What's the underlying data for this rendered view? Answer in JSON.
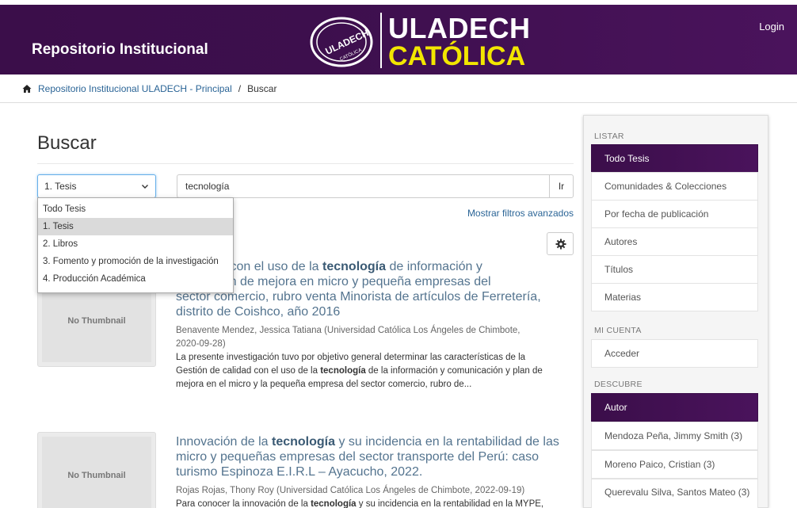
{
  "header": {
    "title": "Repositorio Institucional",
    "logo_word1": "ULADECH",
    "logo_word2": "CATÓLICA",
    "seal_text": "ULADECH CATÓLICA",
    "login": "Login"
  },
  "breadcrumb": {
    "home": "Repositorio Institucional ULADECH - Principal",
    "separator": "/",
    "current": "Buscar"
  },
  "search": {
    "page_title": "Buscar",
    "scope_selected": "1. Tesis",
    "query": "tecnología",
    "go_label": "Ir",
    "advanced_filters": "Mostrar filtros avanzados",
    "scope_options": [
      "Todo Tesis",
      "1. Tesis",
      "2. Libros",
      "3. Fomento y promoción de la investigación",
      "4. Producción Académica"
    ]
  },
  "results": [
    {
      "thumbnail": "No Thumbnail",
      "title_lines": [
        [
          "e calidad con el uso de la ",
          "tecnología",
          " de información y"
        ],
        [
          "ción y plan de mejora en micro y pequeña empresas del"
        ],
        [
          "sector comercio, rubro venta Minorista de artículos de Ferretería,"
        ],
        [
          "distrito de Coishco, año 2016"
        ]
      ],
      "meta_lines": [
        "Benavente Mendez, Jessica Tatiana (Universidad Católica Los Ángeles de Chimbote,",
        "2020-09-28)"
      ],
      "abstract_lines": [
        [
          "La presente investigación tuvo por objetivo general determinar las características de la"
        ],
        [
          "Gestión de calidad con el uso de la ",
          "tecnología",
          " de la información y comunicación y plan de"
        ],
        [
          "mejora en el micro y la pequeña empresa del sector comercio, rubro de..."
        ]
      ]
    },
    {
      "thumbnail": "No Thumbnail",
      "title_lines": [
        [
          "Innovación de la ",
          "tecnología",
          " y su incidencia en la rentabilidad de las"
        ],
        [
          "micro y pequeñas empresas del sector transporte del Perú: caso"
        ],
        [
          "turismo Espinoza E.I.R.L – Ayacucho, 2022."
        ]
      ],
      "meta_lines": [
        "Rojas Rojas, Thony Roy (Universidad Católica Los Ángeles de Chimbote, 2022-09-19)"
      ],
      "abstract_lines": [
        [
          "Para conocer la innovación de la ",
          "tecnología",
          " y su incidencia en la rentabilidad en la MYPE,"
        ]
      ]
    }
  ],
  "sidebar": {
    "listar_heading": "LISTAR",
    "listar_items": [
      "Todo Tesis",
      "Comunidades & Colecciones",
      "Por fecha de publicación",
      "Autores",
      "Títulos",
      "Materias"
    ],
    "cuenta_heading": "MI CUENTA",
    "cuenta_items": [
      "Acceder"
    ],
    "descubre_heading": "DESCUBRE",
    "descubre_items": [
      "Autor",
      "Mendoza Peña, Jimmy Smith (3)",
      "Moreno Paico, Cristian (3)",
      "Querevalu Silva, Santos Mateo (3)"
    ]
  },
  "colors": {
    "header_purple": "#3b0e4a",
    "logo_yellow": "#f2e600",
    "link_blue": "#2a6496",
    "title_blue": "#54748f"
  }
}
